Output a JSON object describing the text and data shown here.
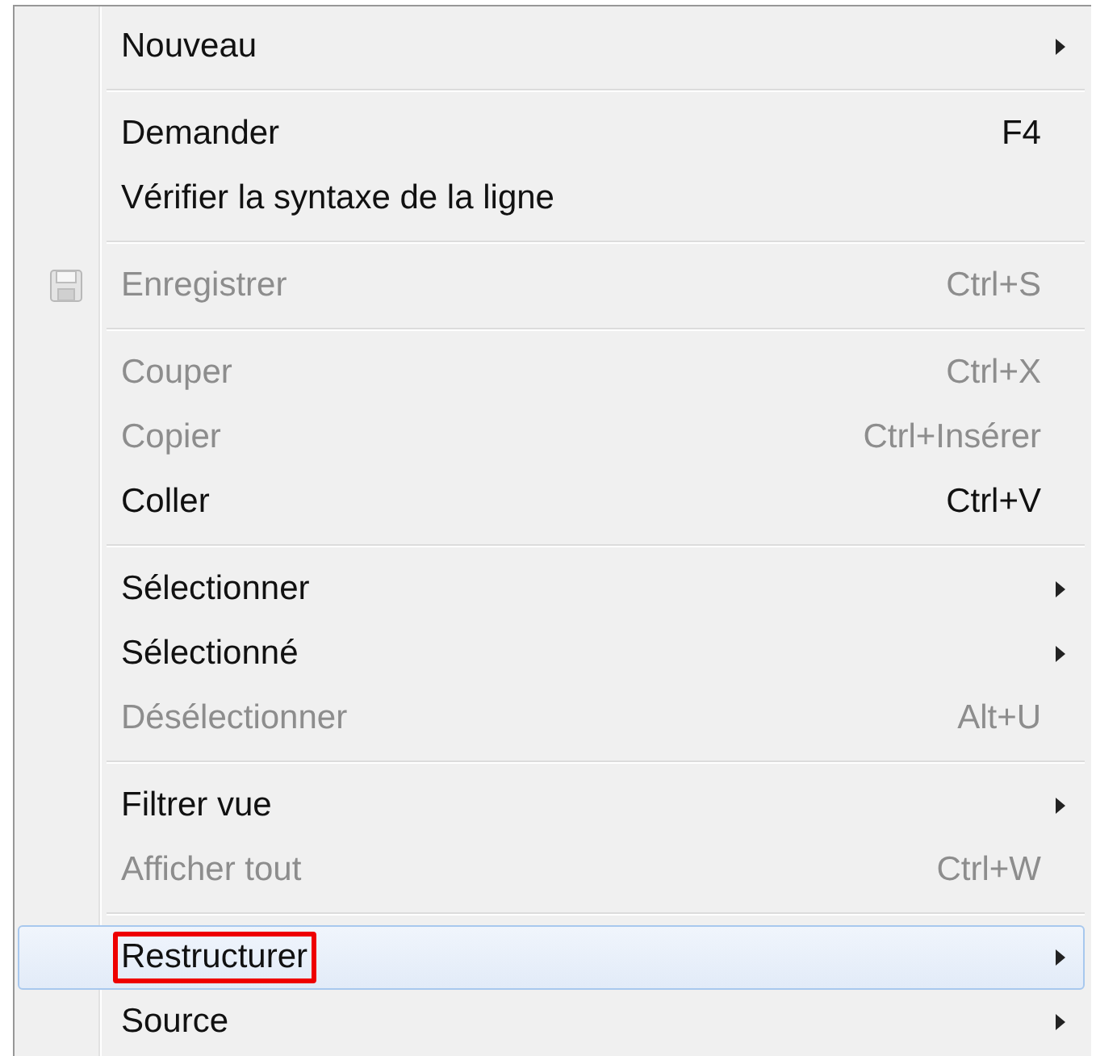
{
  "menu": {
    "groups": [
      {
        "items": [
          {
            "label": "Nouveau",
            "submenu": true,
            "disabled": false,
            "selected": false,
            "highlighted": false
          }
        ]
      },
      {
        "items": [
          {
            "label": "Demander",
            "shortcut": "F4",
            "disabled": false,
            "selected": false,
            "highlighted": false
          },
          {
            "label": "Vérifier la syntaxe de la ligne",
            "disabled": false,
            "selected": false,
            "highlighted": false
          }
        ]
      },
      {
        "items": [
          {
            "label": "Enregistrer",
            "shortcut": "Ctrl+S",
            "has_icon": true,
            "disabled": true,
            "selected": false,
            "highlighted": false
          }
        ]
      },
      {
        "items": [
          {
            "label": "Couper",
            "shortcut": "Ctrl+X",
            "disabled": true,
            "selected": false,
            "highlighted": false
          },
          {
            "label": "Copier",
            "shortcut": "Ctrl+Insérer",
            "disabled": true,
            "selected": false,
            "highlighted": false
          },
          {
            "label": "Coller",
            "shortcut": "Ctrl+V",
            "disabled": false,
            "selected": false,
            "highlighted": false
          }
        ]
      },
      {
        "items": [
          {
            "label": "Sélectionner",
            "submenu": true,
            "disabled": false,
            "selected": false,
            "highlighted": false
          },
          {
            "label": "Sélectionné",
            "submenu": true,
            "disabled": false,
            "selected": false,
            "highlighted": false
          },
          {
            "label": "Désélectionner",
            "shortcut": "Alt+U",
            "disabled": true,
            "selected": false,
            "highlighted": false
          }
        ]
      },
      {
        "items": [
          {
            "label": "Filtrer vue",
            "submenu": true,
            "disabled": false,
            "selected": false,
            "highlighted": false
          },
          {
            "label": "Afficher tout",
            "shortcut": "Ctrl+W",
            "disabled": true,
            "selected": false,
            "highlighted": false
          }
        ]
      },
      {
        "items": [
          {
            "label": "Restructurer",
            "submenu": true,
            "disabled": false,
            "selected": true,
            "highlighted": true
          },
          {
            "label": "Source",
            "submenu": true,
            "disabled": false,
            "selected": false,
            "highlighted": false
          }
        ]
      }
    ]
  }
}
